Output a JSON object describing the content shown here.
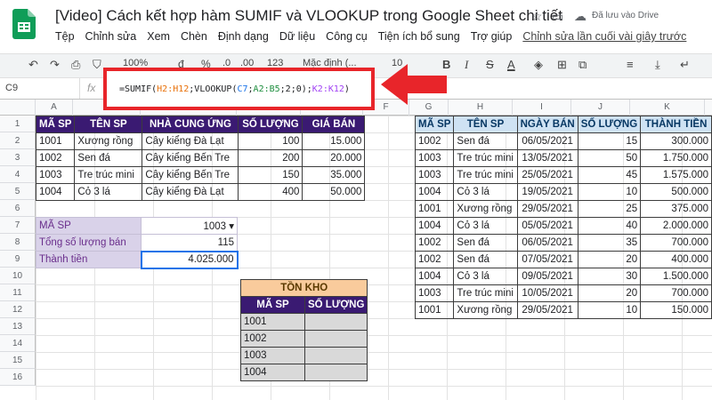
{
  "doc": {
    "title": "[Video] Cách kết hợp hàm SUMIF và VLOOKUP trong Google Sheet chi tiết",
    "saved": "Đã lưu vào Drive"
  },
  "menu": [
    "Tệp",
    "Chỉnh sửa",
    "Xem",
    "Chèn",
    "Định dạng",
    "Dữ liệu",
    "Công cụ",
    "Tiện ích bổ sung",
    "Trợ giúp"
  ],
  "menu_last": "Chỉnh sửa lần cuối vài giây trước",
  "toolbar": {
    "zoom": "100%",
    "currency": "đ",
    "percent": "%",
    "dec0": ".0",
    "dec00": ".00",
    "numfmt": "123",
    "font": "Mặc định (...",
    "size": "10",
    "bold": "B",
    "italic": "I",
    "strike": "S",
    "textcolor": "A"
  },
  "name_box": "C9",
  "formula": [
    {
      "t": "=SUMIF(",
      "c": "#202124"
    },
    {
      "t": "H2:H12",
      "c": "#e8710a"
    },
    {
      "t": ";VLOOKUP(",
      "c": "#202124"
    },
    {
      "t": "C7",
      "c": "#1a73e8"
    },
    {
      "t": ";",
      "c": "#202124"
    },
    {
      "t": "A2:B5",
      "c": "#1e8e3e"
    },
    {
      "t": ";2;0);",
      "c": "#202124"
    },
    {
      "t": "K2:K12",
      "c": "#a142f4"
    },
    {
      "t": ")",
      "c": "#202124"
    }
  ],
  "columns": [
    "A",
    "B",
    "C",
    "D",
    "E",
    "F",
    "G",
    "H",
    "I",
    "J",
    "K"
  ],
  "rows": [
    "1",
    "2",
    "3",
    "4",
    "5",
    "6",
    "7",
    "8",
    "9",
    "10",
    "11",
    "12",
    "13",
    "14",
    "15",
    "16"
  ],
  "products": {
    "headers": [
      "MÃ SP",
      "TÊN SP",
      "NHÀ CUNG ỨNG",
      "SỐ LƯỢNG",
      "GIÁ BÁN"
    ],
    "rows": [
      [
        "1001",
        "Xương rồng",
        "Cây kiểng Đà Lạt",
        "100",
        "15.000"
      ],
      [
        "1002",
        "Sen đá",
        "Cây kiểng Bến Tre",
        "200",
        "20.000"
      ],
      [
        "1003",
        "Tre trúc mini",
        "Cây kiểng Bến Tre",
        "150",
        "35.000"
      ],
      [
        "1004",
        "Cỏ 3 lá",
        "Cây kiểng Đà Lạt",
        "400",
        "50.000"
      ]
    ]
  },
  "lookup": [
    {
      "label": "MÃ SP",
      "value": "1003"
    },
    {
      "label": "Tổng số lượng bán",
      "value": "115"
    },
    {
      "label": "Thành tiền",
      "value": "4.025.000"
    }
  ],
  "stock": {
    "title": "TỒN KHO",
    "headers": [
      "MÃ SP",
      "SỐ LƯỢNG"
    ],
    "rows": [
      "1001",
      "1002",
      "1003",
      "1004"
    ]
  },
  "sales": {
    "headers": [
      "MÃ SP",
      "TÊN SP",
      "NGÀY BÁN",
      "SỐ LƯỢNG",
      "THÀNH TIỀN"
    ],
    "rows": [
      [
        "1002",
        "Sen đá",
        "06/05/2021",
        "15",
        "300.000"
      ],
      [
        "1003",
        "Tre trúc mini",
        "13/05/2021",
        "50",
        "1.750.000"
      ],
      [
        "1003",
        "Tre trúc mini",
        "25/05/2021",
        "45",
        "1.575.000"
      ],
      [
        "1004",
        "Cỏ 3 lá",
        "19/05/2021",
        "10",
        "500.000"
      ],
      [
        "1001",
        "Xương rồng",
        "29/05/2021",
        "25",
        "375.000"
      ],
      [
        "1004",
        "Cỏ 3 lá",
        "05/05/2021",
        "40",
        "2.000.000"
      ],
      [
        "1002",
        "Sen đá",
        "06/05/2021",
        "35",
        "700.000"
      ],
      [
        "1002",
        "Sen đá",
        "07/05/2021",
        "20",
        "400.000"
      ],
      [
        "1004",
        "Cỏ 3 lá",
        "09/05/2021",
        "30",
        "1.500.000"
      ],
      [
        "1003",
        "Tre trúc mini",
        "10/05/2021",
        "20",
        "700.000"
      ],
      [
        "1001",
        "Xương rồng",
        "29/05/2021",
        "10",
        "150.000"
      ]
    ]
  },
  "colors": {
    "header_purple": "#3a1a72",
    "header_blue": "#cfe2f3",
    "label_lilac": "#d9d2e9",
    "stock_title": "#f9cb9c",
    "highlight_red": "#e8252a"
  }
}
